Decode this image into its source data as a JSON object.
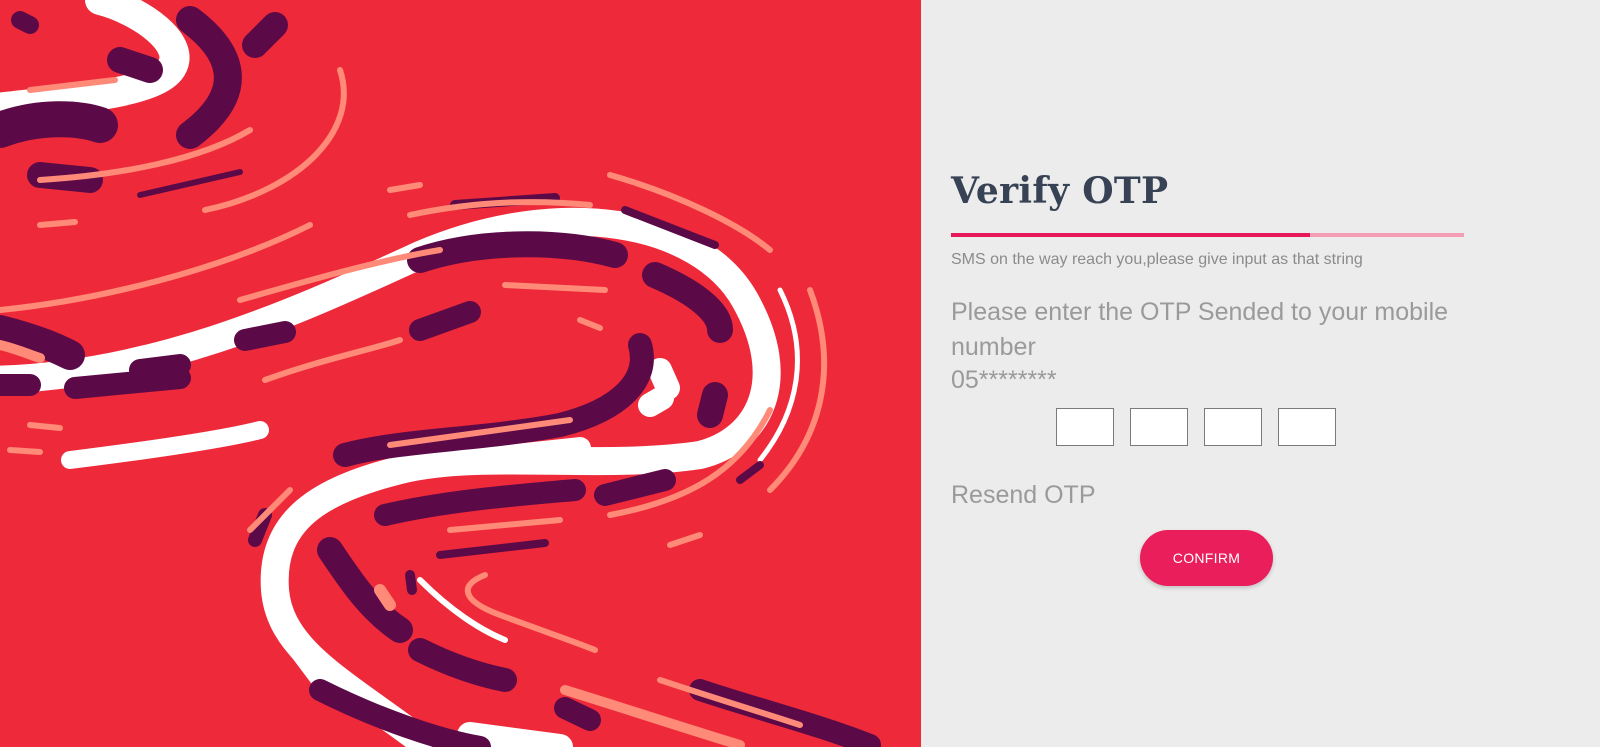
{
  "hero": {
    "background": "#ee2a3a",
    "stroke_colors": {
      "dark": "#5c0a47",
      "white": "#ffffff",
      "salmon": "#ff8a78"
    }
  },
  "verify": {
    "title": "Verify OTP",
    "progress_fraction": 0.7,
    "progress_colors": {
      "fill": "#e8195a",
      "track": "#f59db5"
    },
    "subtitle": "SMS on the way reach you,please give input as that string",
    "instruction": "Please enter the OTP Sended to your mobile number",
    "mobile_masked": "05********",
    "otp_digits": [
      "",
      "",
      "",
      ""
    ],
    "resend_label": "Resend OTP",
    "confirm_label": "CONFIRM",
    "accent_color": "#e91e5a"
  }
}
